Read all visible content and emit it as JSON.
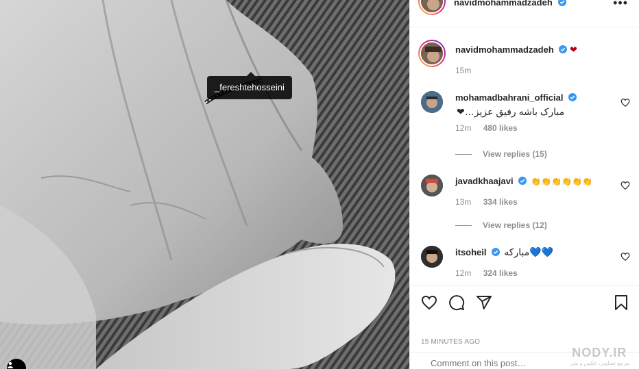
{
  "post": {
    "photo_alt": "black and white photo of two hands, one wearing a ring",
    "tagged_user": "_fereshtehosseini",
    "user_tag_icon": "user-icon"
  },
  "header": {
    "username": "navidmohammadzadeh",
    "more_label": "•••"
  },
  "caption": {
    "username": "navidmohammadzadeh",
    "text": "❤",
    "time": "15m"
  },
  "comments": [
    {
      "username": "mohamadbahrani_official",
      "text": "مبارک باشه رفیق عزیز…❤",
      "time": "12m",
      "likes": "480 likes",
      "replies": "View replies (15)"
    },
    {
      "username": "javadkhaajavi",
      "text": "👏👏👏👏👏👏",
      "time": "13m",
      "likes": "334 likes",
      "replies": "View replies (12)"
    },
    {
      "username": "itsoheil",
      "text": "مبارکه💙💙",
      "time": "12m",
      "likes": "324 likes"
    }
  ],
  "actions": {
    "like_icon": "heart-icon",
    "comment_icon": "comment-icon",
    "share_icon": "share-icon",
    "save_icon": "bookmark-icon"
  },
  "timestamp": "15 MINUTES AGO",
  "add_comment": {
    "placeholder": "Comment on this post…"
  },
  "watermark": {
    "big": "NODY.IR",
    "small": "مرجع تصاویر، عکس و متن"
  },
  "colors": {
    "verified": "#3897f0",
    "heart_red": "#b3000f",
    "muted": "#8e8e8e",
    "text": "#262626",
    "border": "#efefef"
  }
}
